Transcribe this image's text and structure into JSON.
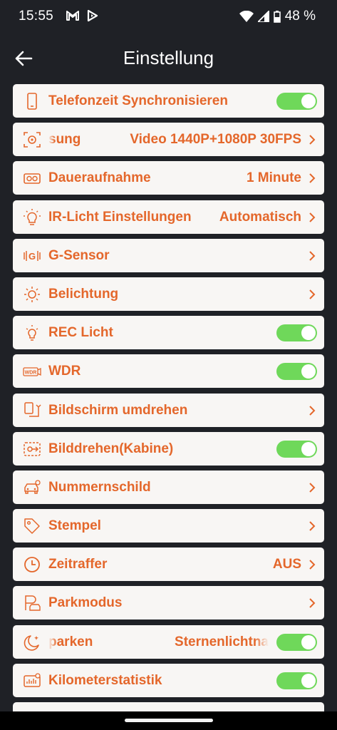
{
  "status_bar": {
    "time": "15:55",
    "battery": "48 %",
    "icons": [
      "gmail-icon",
      "play-store-icon",
      "wifi-icon",
      "signal-icon",
      "battery-icon"
    ]
  },
  "header": {
    "title": "Einstellung",
    "back_icon": "arrow-left-icon"
  },
  "settings": [
    {
      "icon": "phone-icon",
      "label": "Telefonzeit Synchronisieren",
      "value": "",
      "toggle": true
    },
    {
      "icon": "camera-frame-icon",
      "label": "sung",
      "value": "Video 1440P+1080P 30FPS",
      "toggle": false
    },
    {
      "icon": "loop-recording-icon",
      "label": "Daueraufnahme",
      "value": "1 Minute",
      "toggle": false
    },
    {
      "icon": "light-bulb-icon",
      "label": "IR-Licht Einstellungen",
      "value": "Automatisch",
      "toggle": false
    },
    {
      "icon": "g-sensor-icon",
      "label": "G-Sensor",
      "value": "",
      "toggle": false
    },
    {
      "icon": "sun-icon",
      "label": "Belichtung",
      "value": "",
      "toggle": false
    },
    {
      "icon": "bulb-icon",
      "label": "REC Licht",
      "value": "",
      "toggle": true
    },
    {
      "icon": "wdr-icon",
      "label": "WDR",
      "value": "",
      "toggle": true
    },
    {
      "icon": "screen-flip-icon",
      "label": "Bildschirm umdrehen",
      "value": "",
      "toggle": false
    },
    {
      "icon": "image-rotate-icon",
      "label": "Bilddrehen(Kabine)",
      "value": "",
      "toggle": true
    },
    {
      "icon": "car-plate-icon",
      "label": "Nummernschild",
      "value": "",
      "toggle": false
    },
    {
      "icon": "tag-icon",
      "label": "Stempel",
      "value": "",
      "toggle": false
    },
    {
      "icon": "clock-icon",
      "label": "Zeitraffer",
      "value": "AUS",
      "toggle": false
    },
    {
      "icon": "parking-icon",
      "label": "Parkmodus",
      "value": "",
      "toggle": false
    },
    {
      "icon": "moon-icon",
      "label": "parken",
      "value": "Sternenlichtna",
      "toggle": true
    },
    {
      "icon": "mileage-icon",
      "label": "Kilometerstatistik",
      "value": "",
      "toggle": true
    }
  ],
  "colors": {
    "accent": "#e4672b",
    "toggle_on": "#6fd85a",
    "background": "#1f2126",
    "row": "#f8f6f4"
  }
}
